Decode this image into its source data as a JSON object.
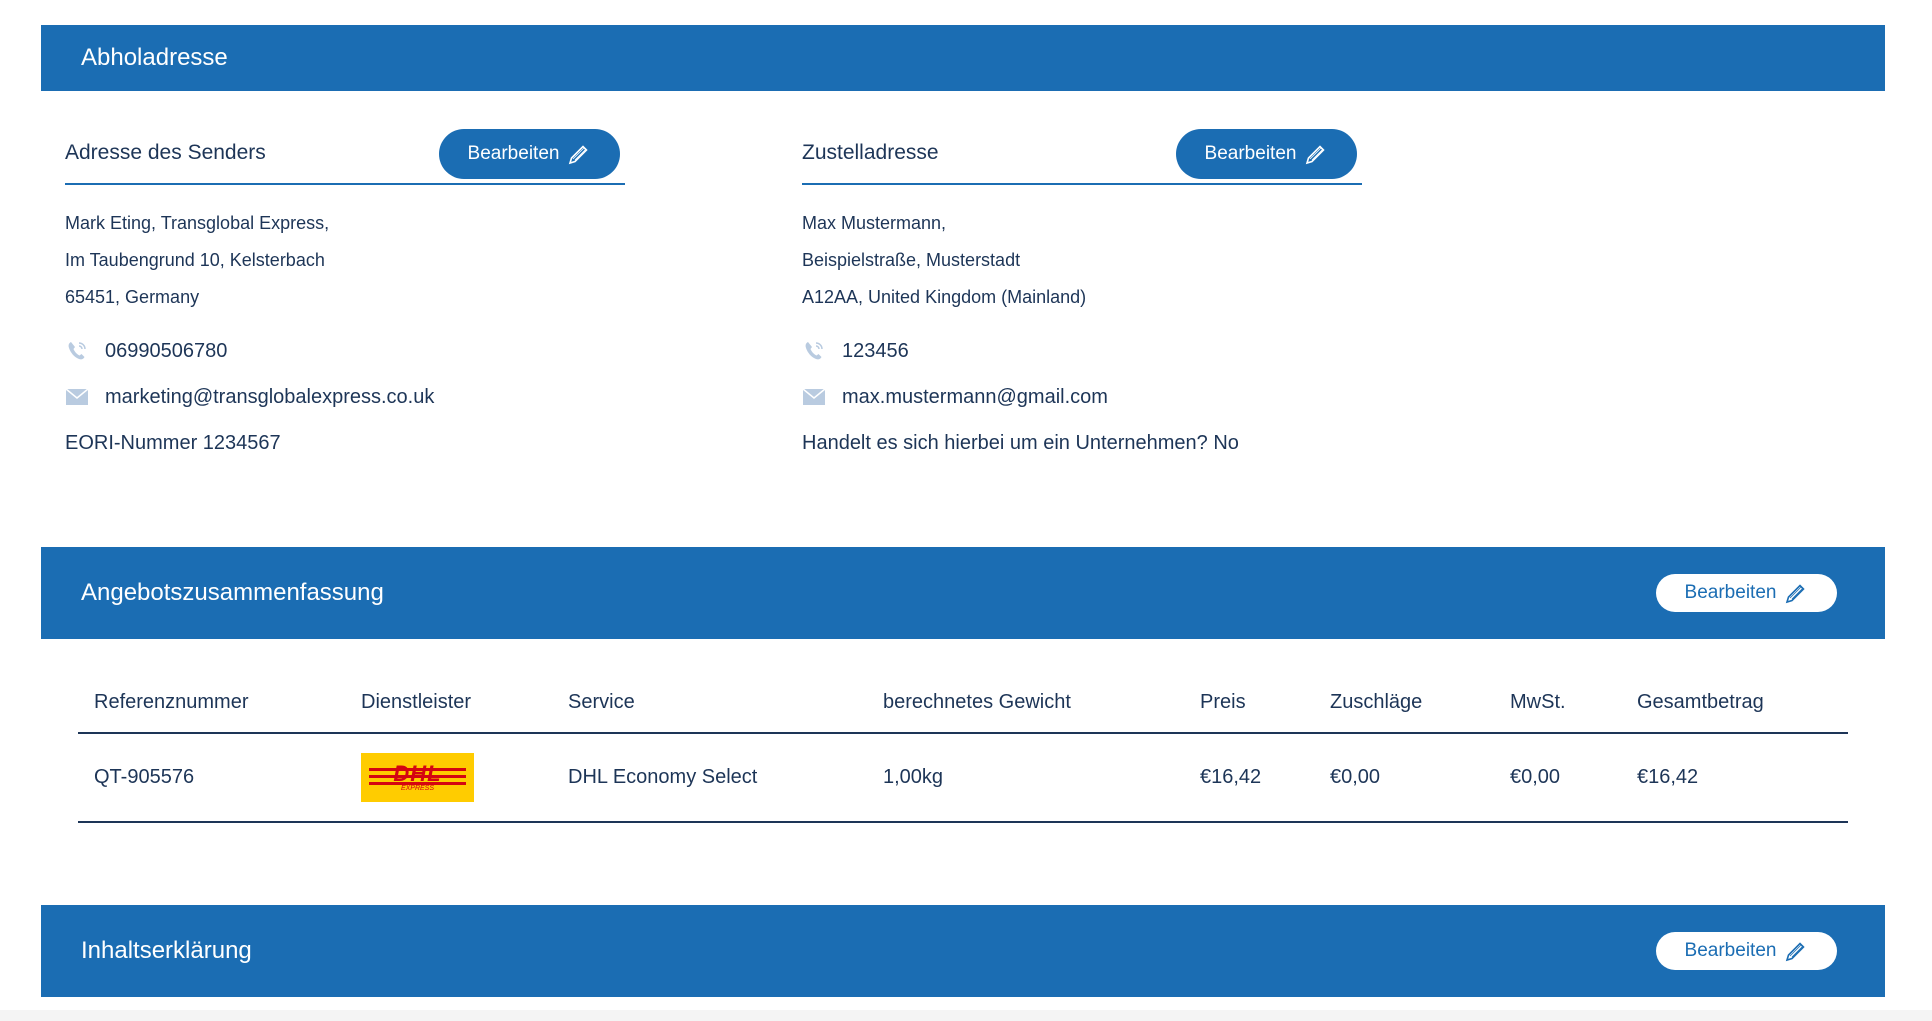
{
  "pickup": {
    "title": "Abholadresse",
    "sender": {
      "heading": "Adresse des Senders",
      "edit_label": "Bearbeiten",
      "address_lines": [
        "Mark Eting, Transglobal Express,",
        "Im Taubengrund 10, Kelsterbach",
        "65451, Germany"
      ],
      "phone": "06990506780",
      "email": "marketing@transglobalexpress.co.uk",
      "extra": "EORI-Nummer 1234567"
    },
    "recipient": {
      "heading": "Zustelladresse",
      "edit_label": "Bearbeiten",
      "address_lines": [
        "Max Mustermann,",
        "Beispielstraße, Musterstadt",
        "A12AA, United Kingdom (Mainland)"
      ],
      "phone": "123456",
      "email": "max.mustermann@gmail.com",
      "extra": "Handelt es sich hierbei um ein Unternehmen? No"
    }
  },
  "quote": {
    "title": "Angebotszusammenfassung",
    "edit_label": "Bearbeiten",
    "columns": [
      "Referenznummer",
      "Dienstleister",
      "Service",
      "berechnetes Gewicht",
      "Preis",
      "Zuschläge",
      "MwSt.",
      "Gesamtbetrag"
    ],
    "row": {
      "reference": "QT-905576",
      "carrier_logo_text": "DHL",
      "carrier_logo_sub": "EXPRESS",
      "service": "DHL Economy Select",
      "weight": "1,00kg",
      "price": "€16,42",
      "surcharges": "€0,00",
      "vat": "€0,00",
      "total": "€16,42"
    }
  },
  "contents": {
    "title": "Inhaltserklärung",
    "edit_label": "Bearbeiten"
  },
  "colors": {
    "accent": "#1b6db3",
    "text": "#1d3557",
    "dhl_yellow": "#ffcc00",
    "dhl_red": "#d40511"
  },
  "icons": {
    "edit": "pencil-icon",
    "phone": "phone-icon",
    "email": "envelope-icon"
  }
}
